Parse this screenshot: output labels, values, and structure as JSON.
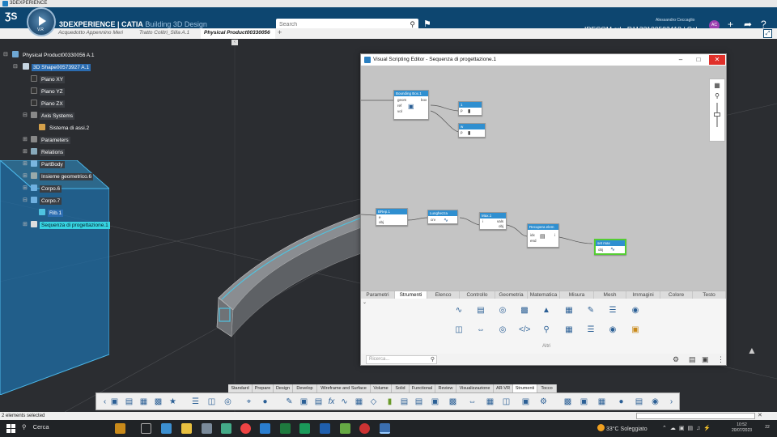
{
  "window": {
    "title": "3DEXPERIENCE"
  },
  "header": {
    "brand_bold": "3DEXPERIENCE | CATIA",
    "brand_sub": "Building 3D Design",
    "compass_version": "V.R",
    "search_placeholder": "Search",
    "user_name": "Alessandro Ceccaglio",
    "company": "IDECOM srl - R1132100582418 | Col...",
    "avatar_initials": "AC",
    "brand_color": "#0d4670"
  },
  "tabs": [
    {
      "label": "Acquedotto Appennino Meri"
    },
    {
      "label": "Tratto Colitri_Silla A.1"
    },
    {
      "label": "Physical Product00330056"
    }
  ],
  "tree": {
    "root": "Physical Product00330056 A.1",
    "shape": "3D Shape00573927 A.1",
    "items": [
      "Piano XY",
      "Piano YZ",
      "Piano ZX",
      "Axis Systems",
      "Sistema di assi.2",
      "Parameters",
      "Relations",
      "PartBody",
      "Insieme geometrico.6",
      "Corpo.6",
      "Corpo.7",
      "Rib.1",
      "Sequenza di progettazione.1"
    ]
  },
  "vse": {
    "title": "Visual Scripting Editor - Sequenza di progettazione.1",
    "nodes": {
      "bbox": {
        "title": "Bounding Box.1",
        "ports": [
          "geom",
          "ref",
          "vol",
          "box"
        ]
      },
      "n1": {
        "title": "1",
        "port": "p"
      },
      "w": {
        "title": "w",
        "port": "p"
      },
      "brep": {
        "title": "BRep.1",
        "ports": [
          "e",
          "obj"
        ]
      },
      "lunghezza": {
        "title": "Lunghezza",
        "ports": [
          "crv"
        ]
      },
      "max": {
        "title": "Max.1",
        "ports": [
          "vals",
          "i",
          "obj"
        ]
      },
      "recupera": {
        "title": "Recupera elem",
        "ports": [
          "idx",
          "end",
          "i"
        ]
      },
      "setmax": {
        "title": "set max",
        "ports": [
          "obj"
        ]
      }
    },
    "tabs": [
      "Parametri",
      "Strumenti",
      "Elenco",
      "Controllo",
      "Geometria",
      "Matematica",
      "Misura",
      "Mesh",
      "Immagini",
      "Colore",
      "Testo"
    ],
    "active_tab": "Strumenti",
    "more_label": "Altri",
    "search_placeholder": "Ricerca..."
  },
  "command_tabs": [
    "Standard",
    "Prepare",
    "Design",
    "Develop",
    "Wireframe and Surface",
    "Volume",
    "Solid",
    "Functional",
    "Review",
    "Visualizzazione",
    "AR-VR",
    "Strumenti",
    "Tocco"
  ],
  "active_command_tab": "Strumenti",
  "status": {
    "text": "2 elements selected"
  },
  "taskbar": {
    "search_label": "Cerca",
    "weather": "33°C  Soleggiato",
    "time": "10:52",
    "date": "20/07/2023",
    "notifications": "22"
  }
}
